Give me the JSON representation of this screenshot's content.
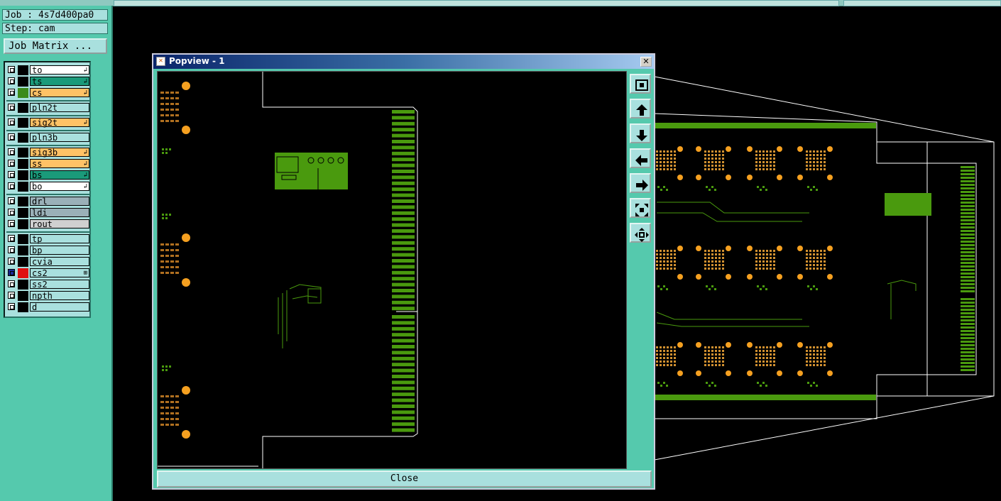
{
  "app": {
    "job_line": "Job : 4s7d400pa0",
    "step_line": "Step: cam",
    "job_matrix_label": "Job Matrix ..."
  },
  "layers": [
    {
      "name": "to",
      "color": "#ffffff",
      "swatch": "#000000",
      "mark": "↲"
    },
    {
      "name": "ts",
      "color": "#1a9a7a",
      "swatch": "#000000",
      "mark": "↲"
    },
    {
      "name": "cs",
      "color": "#ffc266",
      "swatch": "#3a8a1a",
      "mark": "↲"
    },
    {
      "name": "pln2t",
      "color": "#a9e0de",
      "swatch": "#000000",
      "mark": ""
    },
    {
      "name": "sig2t",
      "color": "#ffc266",
      "swatch": "#000000",
      "mark": "↲"
    },
    {
      "name": "pln3b",
      "color": "#a9e0de",
      "swatch": "#000000",
      "mark": ""
    },
    {
      "name": "sig3b",
      "color": "#ffc266",
      "swatch": "#000000",
      "mark": "↲"
    },
    {
      "name": "ss",
      "color": "#ffc266",
      "swatch": "#000000",
      "mark": "↲"
    },
    {
      "name": "bs",
      "color": "#1a9a7a",
      "swatch": "#000000",
      "mark": "↲"
    },
    {
      "name": "bo",
      "color": "#ffffff",
      "swatch": "#000000",
      "mark": "↲"
    },
    {
      "name": "drl",
      "color": "#9ab0b8",
      "swatch": "#000000",
      "mark": ""
    },
    {
      "name": "ldi",
      "color": "#9ab0b8",
      "swatch": "#000000",
      "mark": ""
    },
    {
      "name": "rout",
      "color": "#d0d0d0",
      "swatch": "#000000",
      "mark": ""
    },
    {
      "name": "tp",
      "color": "#a9e0de",
      "swatch": "#000000",
      "mark": ""
    },
    {
      "name": "bp",
      "color": "#a9e0de",
      "swatch": "#000000",
      "mark": ""
    },
    {
      "name": "cvia",
      "color": "#a9e0de",
      "swatch": "#000000",
      "mark": ""
    },
    {
      "name": "cs2",
      "color": "#a9e0de",
      "swatch": "#e01010",
      "mark": "⊞"
    },
    {
      "name": "ss2",
      "color": "#a9e0de",
      "swatch": "#000000",
      "mark": ""
    },
    {
      "name": "npth",
      "color": "#a9e0de",
      "swatch": "#000000",
      "mark": ""
    },
    {
      "name": "d",
      "color": "#a9e0de",
      "swatch": "#000000",
      "mark": ""
    }
  ],
  "popview": {
    "title": "Popview - 1",
    "close_label": "Close",
    "close_x": "✕"
  },
  "toolbar_icons": [
    "zoom-fit-icon",
    "pan-up-icon",
    "pan-down-icon",
    "pan-left-icon",
    "pan-right-icon",
    "zoom-in-icon",
    "zoom-out-icon"
  ],
  "colors": {
    "panel": "#55c9ad",
    "copper": "#4a9a0e",
    "pad": "#f5a020",
    "outline": "#ffffff"
  }
}
